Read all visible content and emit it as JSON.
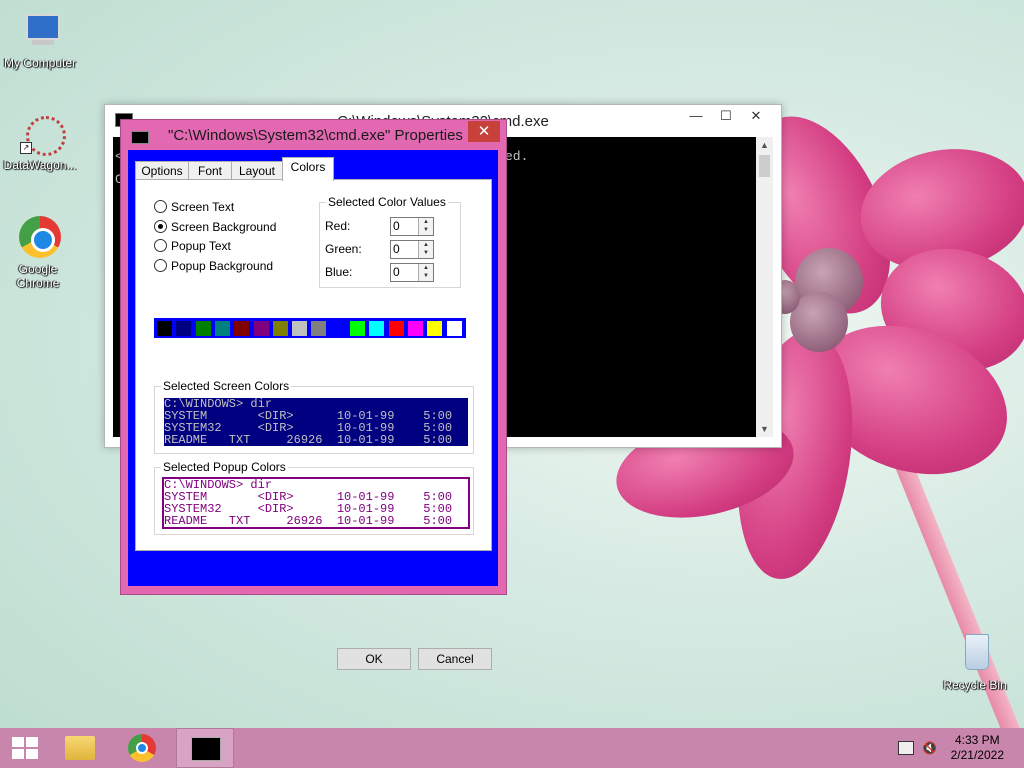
{
  "desktop": {
    "icons": [
      {
        "label": "My Computer"
      },
      {
        "label": "DataWagon..."
      },
      {
        "label": "Google Chrome"
      },
      {
        "label": "Recycle Bin"
      }
    ]
  },
  "cmd_window": {
    "title": "C:\\Windows\\System32\\cmd.exe",
    "console_lines": [
      "ed.",
      "<",
      "C"
    ],
    "controls": {
      "minimize": "—",
      "maximize": "☐",
      "close": "✕"
    }
  },
  "properties_dialog": {
    "title": "\"C:\\Windows\\System32\\cmd.exe\" Properties",
    "close_glyph": "✕",
    "tabs": [
      {
        "label": "Options"
      },
      {
        "label": "Font"
      },
      {
        "label": "Layout"
      },
      {
        "label": "Colors"
      }
    ],
    "active_tab": "Colors",
    "radio_options": [
      {
        "label": "Screen Text",
        "selected": false
      },
      {
        "label": "Screen Background",
        "selected": true
      },
      {
        "label": "Popup Text",
        "selected": false
      },
      {
        "label": "Popup Background",
        "selected": false
      }
    ],
    "selected_color_values": {
      "title": "Selected Color Values",
      "red_label": "Red:",
      "red": "0",
      "green_label": "Green:",
      "green": "0",
      "blue_label": "Blue:",
      "blue": "0"
    },
    "palette_colors": [
      "#000000",
      "#000080",
      "#008000",
      "#008080",
      "#800000",
      "#800080",
      "#808000",
      "#c0c0c0",
      "#808080",
      "#0000ff",
      "#00ff00",
      "#00ffff",
      "#ff0000",
      "#ff00ff",
      "#ffff00",
      "#ffffff"
    ],
    "selected_screen_colors": {
      "title": "Selected Screen Colors",
      "lines": [
        "C:\\WINDOWS> dir",
        "SYSTEM       <DIR>      10-01-99    5:00",
        "SYSTEM32     <DIR>      10-01-99    5:00",
        "README   TXT     26926  10-01-99    5:00"
      ],
      "fg": "#c0c0c0",
      "bg": "#000080"
    },
    "selected_popup_colors": {
      "title": "Selected Popup Colors",
      "lines": [
        "C:\\WINDOWS> dir",
        "SYSTEM       <DIR>      10-01-99    5:00",
        "SYSTEM32     <DIR>      10-01-99    5:00",
        "README   TXT     26926  10-01-99    5:00"
      ],
      "fg": "#800080",
      "bg": "#ffffff"
    },
    "ok_label": "OK",
    "cancel_label": "Cancel"
  },
  "taskbar": {
    "time": "4:33 PM",
    "date": "2/21/2022"
  }
}
